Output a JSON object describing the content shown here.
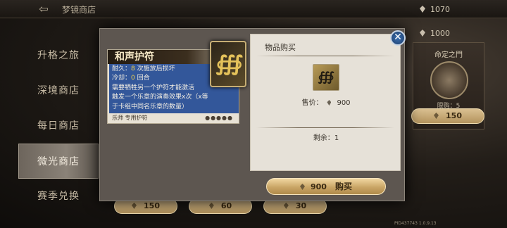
{
  "header": {
    "back_icon": "back-arrow-icon",
    "title": "梦镜商店",
    "currency_top": "1070",
    "currency_second": "1000"
  },
  "sidebar": {
    "items": [
      {
        "label": "升格之旅",
        "active": false
      },
      {
        "label": "深境商店",
        "active": false
      },
      {
        "label": "每日商店",
        "active": false
      },
      {
        "label": "微光商店",
        "active": true
      },
      {
        "label": "赛季兑换",
        "active": false
      }
    ]
  },
  "right_card": {
    "name": "命定之門",
    "limit": "限购：5",
    "price": "150"
  },
  "bottom_prices": [
    "150",
    "60",
    "30"
  ],
  "tooltip": {
    "name": "和声护符",
    "lines": [
      {
        "label": "耐久：",
        "num": "8",
        "rest": " 次施放后损坏"
      },
      {
        "label": "冷却：",
        "num": "0",
        "rest": " 回合"
      }
    ],
    "desc": [
      "需要牺牲另一个护符才能激活",
      "触发一个乐章的演奏效果x次（x等",
      "于卡组中同名乐章的数量）"
    ],
    "footer": "乐师 专用护符",
    "stars": "●●●●●"
  },
  "purchase": {
    "title": "物品购买",
    "price_label": "售价：",
    "price": "900",
    "remain_label": "剩余：",
    "remain": "1",
    "buy_price": "900",
    "buy_label": "购买"
  },
  "close_icon": "close-icon",
  "version": "PID437743  1.0.9.13",
  "colors": {
    "accent_gold": "#c9a566",
    "tooltip_blue": "#33579a",
    "close_blue": "#3b6fb0"
  }
}
